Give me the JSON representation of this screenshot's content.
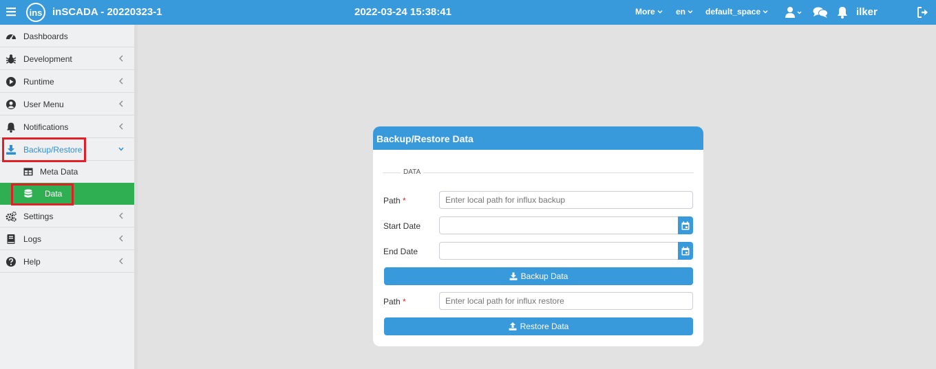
{
  "topbar": {
    "app_title": "inSCADA - 20220323-1",
    "logo_text": "ins",
    "datetime": "2022-03-24 15:38:41",
    "more_label": "More",
    "language": "en",
    "space": "default_space",
    "username": "ilker"
  },
  "sidebar": {
    "items": [
      {
        "label": "Dashboards",
        "icon": "dashboard-icon"
      },
      {
        "label": "Development",
        "icon": "bug-icon"
      },
      {
        "label": "Runtime",
        "icon": "runtime-icon"
      },
      {
        "label": "User Menu",
        "icon": "user-circle-icon"
      },
      {
        "label": "Notifications",
        "icon": "bell-icon"
      },
      {
        "label": "Backup/Restore",
        "icon": "download-icon"
      },
      {
        "label": "Settings",
        "icon": "gears-icon"
      },
      {
        "label": "Logs",
        "icon": "book-icon"
      },
      {
        "label": "Help",
        "icon": "question-circle-icon"
      }
    ],
    "sub_items": [
      {
        "label": "Meta Data",
        "icon": "table-icon"
      },
      {
        "label": "Data",
        "icon": "database-icon"
      }
    ]
  },
  "card": {
    "title": "Backup/Restore Data",
    "legend": "DATA",
    "path_label": "Path",
    "required_mark": "*",
    "backup_path_placeholder": "Enter local path for influx backup",
    "start_date_label": "Start Date",
    "end_date_label": "End Date",
    "backup_button": "Backup Data",
    "restore_path_label": "Path",
    "restore_path_placeholder": "Enter local path for influx restore",
    "restore_button": "Restore Data"
  },
  "colors": {
    "primary": "#3899db",
    "selected": "#2fae52",
    "highlight": "#e01f26",
    "background": "#e2e2e2"
  }
}
